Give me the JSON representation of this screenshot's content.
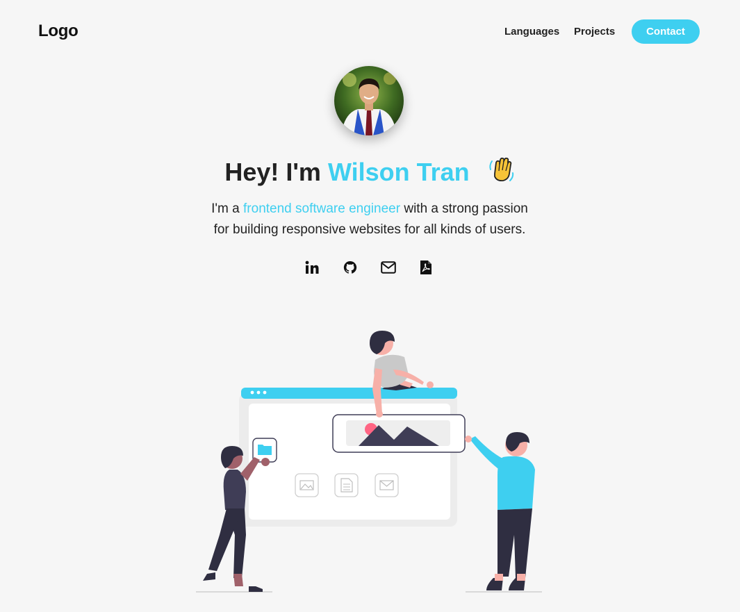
{
  "nav": {
    "logo": "Logo",
    "links": [
      "Languages",
      "Projects"
    ],
    "contact_label": "Contact"
  },
  "hero": {
    "greeting": "Hey! I'm",
    "name": "Wilson Tran",
    "bio_prefix": "I'm a",
    "bio_role": "frontend software engineer",
    "bio_line1_suffix": "with a strong passion",
    "bio_line2": "for building responsive websites for all kinds of users."
  },
  "social": [
    "linkedin-icon",
    "github-icon",
    "mail-icon",
    "pdf-icon"
  ],
  "colors": {
    "accent": "#3ecff0",
    "background": "#f6f6f6",
    "text": "#222222"
  }
}
